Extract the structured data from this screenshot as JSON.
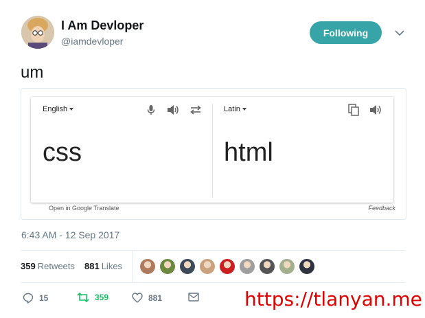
{
  "user": {
    "display_name": "I Am Devloper",
    "handle": "@iamdevloper",
    "avatar_icon": "profile-avatar"
  },
  "follow_button": {
    "label": "Following",
    "color": "#37a5a8"
  },
  "menu_icon": "chevron-down-icon",
  "tweet": {
    "text": "um"
  },
  "translate_card": {
    "source": {
      "language": "English",
      "text": "css"
    },
    "target": {
      "language": "Latin",
      "text": "html"
    },
    "icons": [
      "microphone-icon",
      "speaker-icon",
      "swap-icon",
      "copy-icon",
      "speaker-icon"
    ],
    "footer_link": "Open in Google Translate",
    "feedback": "Feedback"
  },
  "timestamp": "6:43 AM - 12 Sep 2017",
  "stats": {
    "retweets_count": "359",
    "retweets_label": "Retweets",
    "likes_count": "881",
    "likes_label": "Likes"
  },
  "likers": [
    {
      "color": "#b07a5c"
    },
    {
      "color": "#6b8a3e"
    },
    {
      "color": "#3c4a5a"
    },
    {
      "color": "#caa27d"
    },
    {
      "color": "#cc2020"
    },
    {
      "color": "#9e9e9e"
    },
    {
      "color": "#555555"
    },
    {
      "color": "#a3b08e"
    },
    {
      "color": "#2d3340"
    }
  ],
  "actions": {
    "reply_count": "15",
    "retweet_count": "359",
    "like_count": "881",
    "retweet_color": "#17bf63"
  },
  "watermark": "https://tlanyan.me"
}
